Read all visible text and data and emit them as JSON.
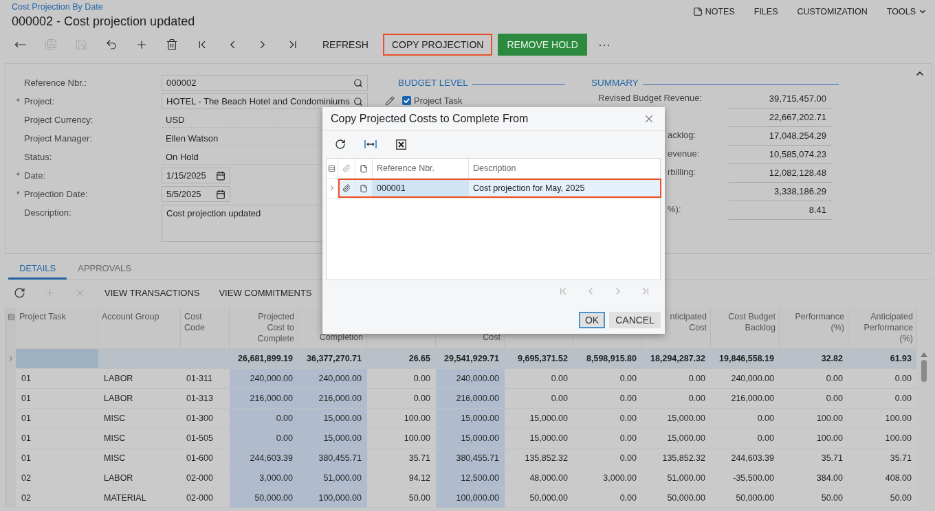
{
  "header": {
    "breadcrumb": "Cost Projection By Date",
    "title": "000002 - Cost projection updated",
    "links": [
      {
        "label": "NOTES",
        "kind": "notes"
      },
      {
        "label": "FILES",
        "kind": "plain"
      },
      {
        "label": "CUSTOMIZATION",
        "kind": "plain"
      },
      {
        "label": "TOOLS",
        "kind": "menu"
      }
    ]
  },
  "toolbar": {
    "icon_buttons": [
      {
        "disabled": false
      },
      {
        "disabled": true
      },
      {
        "disabled": true
      },
      {
        "disabled": false
      },
      {
        "disabled": false
      },
      {
        "disabled": false
      },
      {
        "disabled": false
      },
      {
        "disabled": false
      },
      {
        "disabled": false
      },
      {
        "disabled": false
      }
    ],
    "buttons": [
      {
        "label": "REFRESH",
        "kind": "plain",
        "highlighted": false
      },
      {
        "label": "COPY PROJECTION",
        "kind": "plain",
        "highlighted": true
      },
      {
        "label": "REMOVE HOLD",
        "kind": "primary",
        "highlighted": false
      }
    ],
    "more": "···"
  },
  "form": {
    "fields": [
      {
        "label": "Reference Nbr.:",
        "value": "000002",
        "kind": "lookup"
      },
      {
        "label": "Project:",
        "marker": "*",
        "value": "HOTEL - The Beach Hotel and Condominiums",
        "kind": "lookup"
      },
      {
        "label": "Project Currency:",
        "value": "USD",
        "kind": "text"
      },
      {
        "label": "Project Manager:",
        "value": "Ellen Watson",
        "kind": "text"
      },
      {
        "label": "Status:",
        "value": "On Hold",
        "kind": "text"
      },
      {
        "label": "Date:",
        "marker": "*",
        "value": "1/15/2025",
        "kind": "date"
      },
      {
        "label": "Projection Date:",
        "marker": "*",
        "value": "5/5/2025",
        "kind": "date"
      },
      {
        "label": "Description:",
        "value": "Cost projection updated",
        "kind": "area"
      }
    ],
    "budget_level": {
      "title": "BUDGET LEVEL",
      "options": [
        {
          "label": "Project Task",
          "checked": true
        }
      ]
    },
    "summary": {
      "title": "SUMMARY",
      "rows": [
        {
          "label": "Revised Budget Revenue:",
          "clipped": false,
          "value": "39,715,457.00"
        },
        {
          "value": "22,667,202.71"
        },
        {
          "label": "acklog:",
          "clipped": true,
          "value": "17,048,254.29"
        },
        {
          "label": "evenue:",
          "clipped": true,
          "value": "10,585,074.23"
        },
        {
          "label": "rbilling:",
          "clipped": true,
          "value": "12,082,128.48"
        },
        {
          "value": "3,338,186.29"
        },
        {
          "label": "%):",
          "clipped": true,
          "value": "8.41"
        }
      ]
    }
  },
  "tabs": [
    {
      "label": "DETAILS",
      "selected": true
    },
    {
      "label": "APPROVALS",
      "selected": false
    }
  ],
  "grid_toolbar": {
    "icon_buttons": [
      {
        "disabled": false
      },
      {
        "disabled": true
      },
      {
        "disabled": true
      }
    ],
    "buttons": [
      "VIEW TRANSACTIONS",
      "VIEW COMMITMENTS"
    ]
  },
  "grid": {
    "columns": [
      {
        "lines": [
          "Project Task"
        ],
        "numeric": false,
        "editable": false,
        "clipped": false
      },
      {
        "lines": [
          "Account Group"
        ],
        "numeric": false,
        "editable": false,
        "clipped": false
      },
      {
        "lines": [
          "Cost",
          "Code"
        ],
        "numeric": false,
        "editable": false,
        "clipped": false
      },
      {
        "lines": [
          "Projected",
          "Cost to",
          "Complete"
        ],
        "numeric": true,
        "editable": true,
        "clipped": false
      },
      {
        "lines": [
          "Completion"
        ],
        "numeric": true,
        "editable": true,
        "clipped": true
      },
      {
        "numeric": true,
        "editable": false
      },
      {
        "lines": [
          "Cost"
        ],
        "numeric": true,
        "editable": true,
        "clipped": true
      },
      {
        "numeric": true,
        "editable": false
      },
      {
        "numeric": true,
        "editable": false
      },
      {
        "lines": [
          "nticipated",
          "Cost"
        ],
        "numeric": true,
        "editable": false,
        "clipped": false
      },
      {
        "lines": [
          "Cost Budget",
          "Backlog"
        ],
        "numeric": true,
        "editable": false,
        "clipped": false
      },
      {
        "lines": [
          "Performance",
          "(%)"
        ],
        "numeric": true,
        "editable": false,
        "clipped": false
      },
      {
        "lines": [
          "Anticipated",
          "Performance",
          "(%)"
        ],
        "numeric": true,
        "editable": false,
        "clipped": false
      }
    ],
    "rows": [
      {
        "total": true,
        "current": true,
        "cells": [
          null,
          null,
          null,
          "26,681,899.19",
          "36,377,270.71",
          "26.65",
          "29,541,929.71",
          "9,695,371.52",
          "8,598,915.80",
          "18,294,287.32",
          "19,846,558.19",
          "32.82",
          "61.93"
        ]
      },
      {
        "total": false,
        "current": false,
        "cells": [
          "01",
          "LABOR",
          "01-311",
          "240,000.00",
          "240,000.00",
          "0.00",
          "240,000.00",
          "0.00",
          "0.00",
          "0.00",
          "240,000.00",
          "0.00",
          "0.00"
        ]
      },
      {
        "total": false,
        "current": false,
        "cells": [
          "01",
          "LABOR",
          "01-313",
          "216,000.00",
          "216,000.00",
          "0.00",
          "216,000.00",
          "0.00",
          "0.00",
          "0.00",
          "216,000.00",
          "0.00",
          "0.00"
        ]
      },
      {
        "total": false,
        "current": false,
        "cells": [
          "01",
          "MISC",
          "01-300",
          "0.00",
          "15,000.00",
          "100.00",
          "15,000.00",
          "15,000.00",
          "0.00",
          "15,000.00",
          "0.00",
          "100.00",
          "100.00"
        ]
      },
      {
        "total": false,
        "current": false,
        "cells": [
          "01",
          "MISC",
          "01-505",
          "0.00",
          "15,000.00",
          "100.00",
          "15,000.00",
          "15,000.00",
          "0.00",
          "15,000.00",
          "0.00",
          "100.00",
          "100.00"
        ]
      },
      {
        "total": false,
        "current": false,
        "cells": [
          "01",
          "MISC",
          "01-600",
          "244,603.39",
          "380,455.71",
          "35.71",
          "380,455.71",
          "135,852.32",
          "0.00",
          "135,852.32",
          "244,603.39",
          "35.71",
          "35.71"
        ]
      },
      {
        "total": false,
        "current": false,
        "cells": [
          "02",
          "LABOR",
          "02-000",
          "3,000.00",
          "51,000.00",
          "94.12",
          "12,500.00",
          "48,000.00",
          "3,000.00",
          "51,000.00",
          "-35,500.00",
          "384.00",
          "408.00"
        ]
      },
      {
        "total": false,
        "current": false,
        "cells": [
          "02",
          "MATERIAL",
          "02-000",
          "50,000.00",
          "100,000.00",
          "50.00",
          "100,000.00",
          "50,000.00",
          "0.00",
          "50,000.00",
          "50,000.00",
          "50.00",
          "50.00"
        ]
      }
    ]
  },
  "dialog": {
    "title": "Copy Projected Costs to Complete From",
    "columns": [
      "Reference Nbr.",
      "Description"
    ],
    "rows": [
      {
        "reference": "000001",
        "description": "Cost projection for May, 2025",
        "selected": true,
        "highlighted": true
      }
    ],
    "buttons": [
      {
        "label": "OK",
        "focused": true
      },
      {
        "label": "CANCEL",
        "focused": false
      }
    ]
  }
}
